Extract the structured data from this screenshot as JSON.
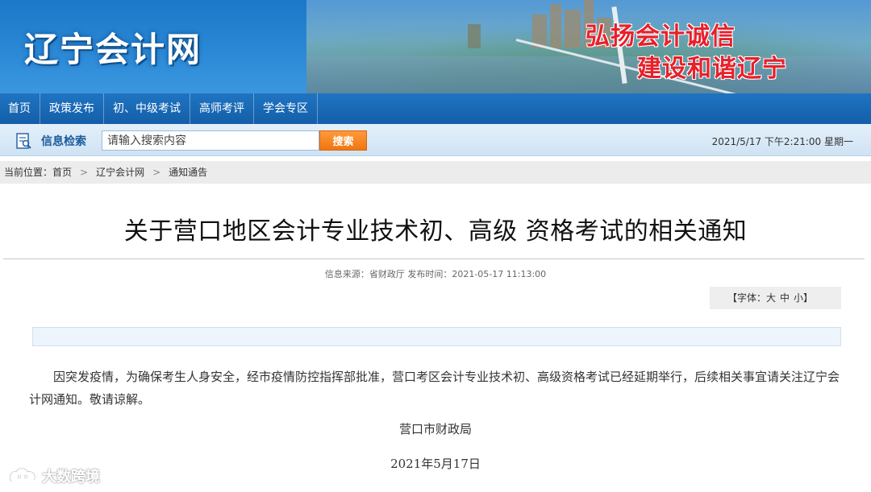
{
  "banner": {
    "site_logo": "辽宁会计网",
    "slogan_line1": "弘扬会计诚信",
    "slogan_line2": "建设和谐辽宁"
  },
  "nav": {
    "items": [
      "首页",
      "政策发布",
      "初、中级考试",
      "高师考评",
      "学会专区"
    ]
  },
  "search": {
    "title": "信息检索",
    "placeholder": "请输入搜索内容",
    "button_label": "搜索",
    "datetime": "2021/5/17  下午2:21:00  星期一"
  },
  "breadcrumb": {
    "prefix": "当前位置：",
    "items": [
      "首页",
      "辽宁会计网",
      "通知通告"
    ],
    "separator": ">"
  },
  "article": {
    "title": "关于营口地区会计专业技术初、高级 资格考试的相关通知",
    "meta": "信息来源：省财政厅  发布时间：2021-05-17 11:13:00",
    "font_label": "【字体：",
    "font_large": "大",
    "font_medium": "中",
    "font_small": "小】",
    "body": "因突发疫情，为确保考生人身安全，经市疫情防控指挥部批准，营口考区会计专业技术初、高级资格考试已经延期举行，后续相关事宜请关注辽宁会计网通知。敬请谅解。",
    "signature": "营口市财政局",
    "date": "2021年5月17日"
  },
  "watermark": {
    "text": "大数跨境"
  }
}
